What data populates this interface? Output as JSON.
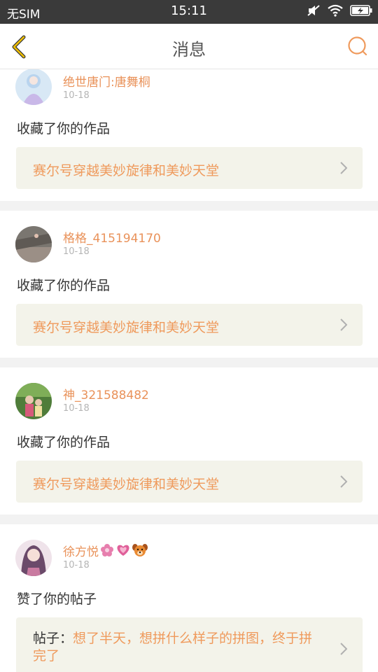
{
  "status_bar": {
    "carrier": "无SIM",
    "time": "15:11",
    "icons": [
      "mute-icon",
      "wifi-icon",
      "battery-charging-icon"
    ]
  },
  "nav": {
    "title": "消息",
    "back_icon": "chevron-left-icon",
    "search_icon": "search-icon"
  },
  "colors": {
    "accent": "#ef9a5c",
    "username": "#e9925a",
    "link_bg": "#f3f3ea",
    "separator": "#f2f2f2",
    "status_bar_bg": "#3a3a3a"
  },
  "messages": [
    {
      "username": "绝世唐门:唐舞桐",
      "date": "10-18",
      "action": "收藏了你的作品",
      "link_text": "赛尔号穿越美妙旋律和美妙天堂"
    },
    {
      "username": "格格_415194170",
      "date": "10-18",
      "action": "收藏了你的作品",
      "link_text": "赛尔号穿越美妙旋律和美妙天堂"
    },
    {
      "username": "神_321588482",
      "date": "10-18",
      "action": "收藏了你的作品",
      "link_text": "赛尔号穿越美妙旋律和美妙天堂"
    },
    {
      "username": "徐方悦",
      "username_emojis": [
        "flower-icon",
        "heart-icon",
        "dog-icon"
      ],
      "date": "10-18",
      "action": "赞了你的帖子",
      "post_prefix": "帖子：",
      "link_text": "想了半天，想拼什么样子的拼图，终于拼完了"
    }
  ]
}
